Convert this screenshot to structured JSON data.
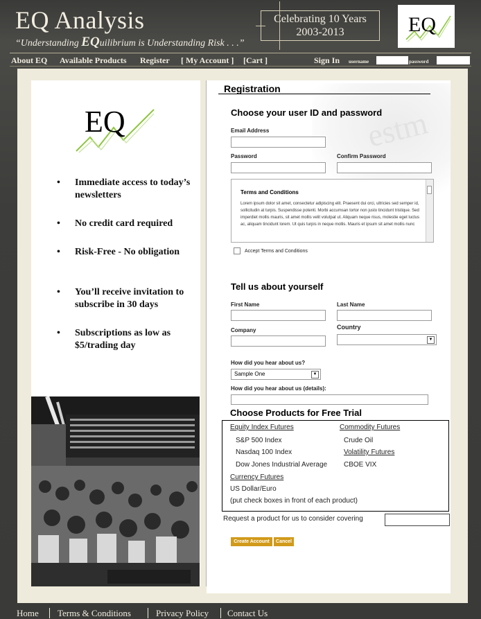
{
  "header": {
    "brand": "EQ Analysis",
    "tagline_before": "“Understanding ",
    "tagline_big": "EQ",
    "tagline_after": "uilibrium is Understanding Risk . . .”",
    "celebrate_line1": "Celebrating 10 Years",
    "celebrate_line2": "2003-2013",
    "logo_text": "EQ"
  },
  "nav": {
    "items": [
      "About EQ",
      "Available Products",
      "Register",
      "[ My Account ]",
      "[Cart ]"
    ],
    "sign_in": "Sign In",
    "username_label": "username",
    "password_label": "password"
  },
  "left": {
    "logo_text": "EQ",
    "bullets": [
      "Immediate access to today’s newsletters",
      "No credit card required",
      "Risk-Free - No obligation",
      "You’ll receive invitation to subscribe in 30 days",
      "Subscriptions as low as $5/trading day"
    ]
  },
  "form": {
    "title": "Registration",
    "section1": "Choose your user ID and password",
    "email_label": "Email Address",
    "password_label": "Password",
    "confirm_label": "Confirm Password",
    "terms_title": "Terms and Conditions",
    "terms_body": "Lorem ipsum dolor sit amet, consectetur adipiscing elit. Praesent dui orci, ultricies sed semper id, sollicitudin at turpis. Suspendisse potenti. Morbi accumsan tortor non justo tincidunt tristique. Sed imperdiet mollis mauris, sit amet mollis velit volutpat ut. Aliquam neque risus, molestie eget luctus ac, aliquam tincidunt lorem. Ut quis turpis in neque mollis. Mauris et ipsum sit amet mollis nunc",
    "accept_label": "Accept Terms and Conditions",
    "section2": "Tell us about yourself",
    "first_name_label": "First Name",
    "last_name_label": "Last Name",
    "company_label": "Company",
    "country_label": "Country",
    "hear_label": "How did you hear about us?",
    "hear_value": "Sample One",
    "hear_details_label": "How did you hear about us (details):",
    "section3": "Choose Products for Free Trial",
    "request_label": "Request a product for us to consider covering",
    "create_button": "Create Account",
    "cancel_button": "Cancel"
  },
  "products": {
    "equity_heading": "Equity Index Futures",
    "equity_items": [
      "S&P 500 Index",
      "Nasdaq 100 Index",
      "Dow Jones Industrial Average"
    ],
    "commodity_heading": "Commodity Futures",
    "commodity_items": [
      "Crude Oil"
    ],
    "volatility_heading": "Volatility Futures",
    "volatility_items": [
      "CBOE VIX"
    ],
    "currency_heading": "Currency Futures",
    "currency_items": [
      "US Dollar/Euro"
    ],
    "note": "(put check boxes in front of each product)"
  },
  "footer": {
    "links": [
      "Home",
      "Terms & Conditions",
      "Privacy Policy",
      "Contact Us"
    ]
  },
  "colors": {
    "background": "#3a3a38",
    "frame": "#efebdc",
    "header_text": "#f2eee0",
    "button": "#d19a1a",
    "logo_swoosh": "#8dc63f"
  }
}
